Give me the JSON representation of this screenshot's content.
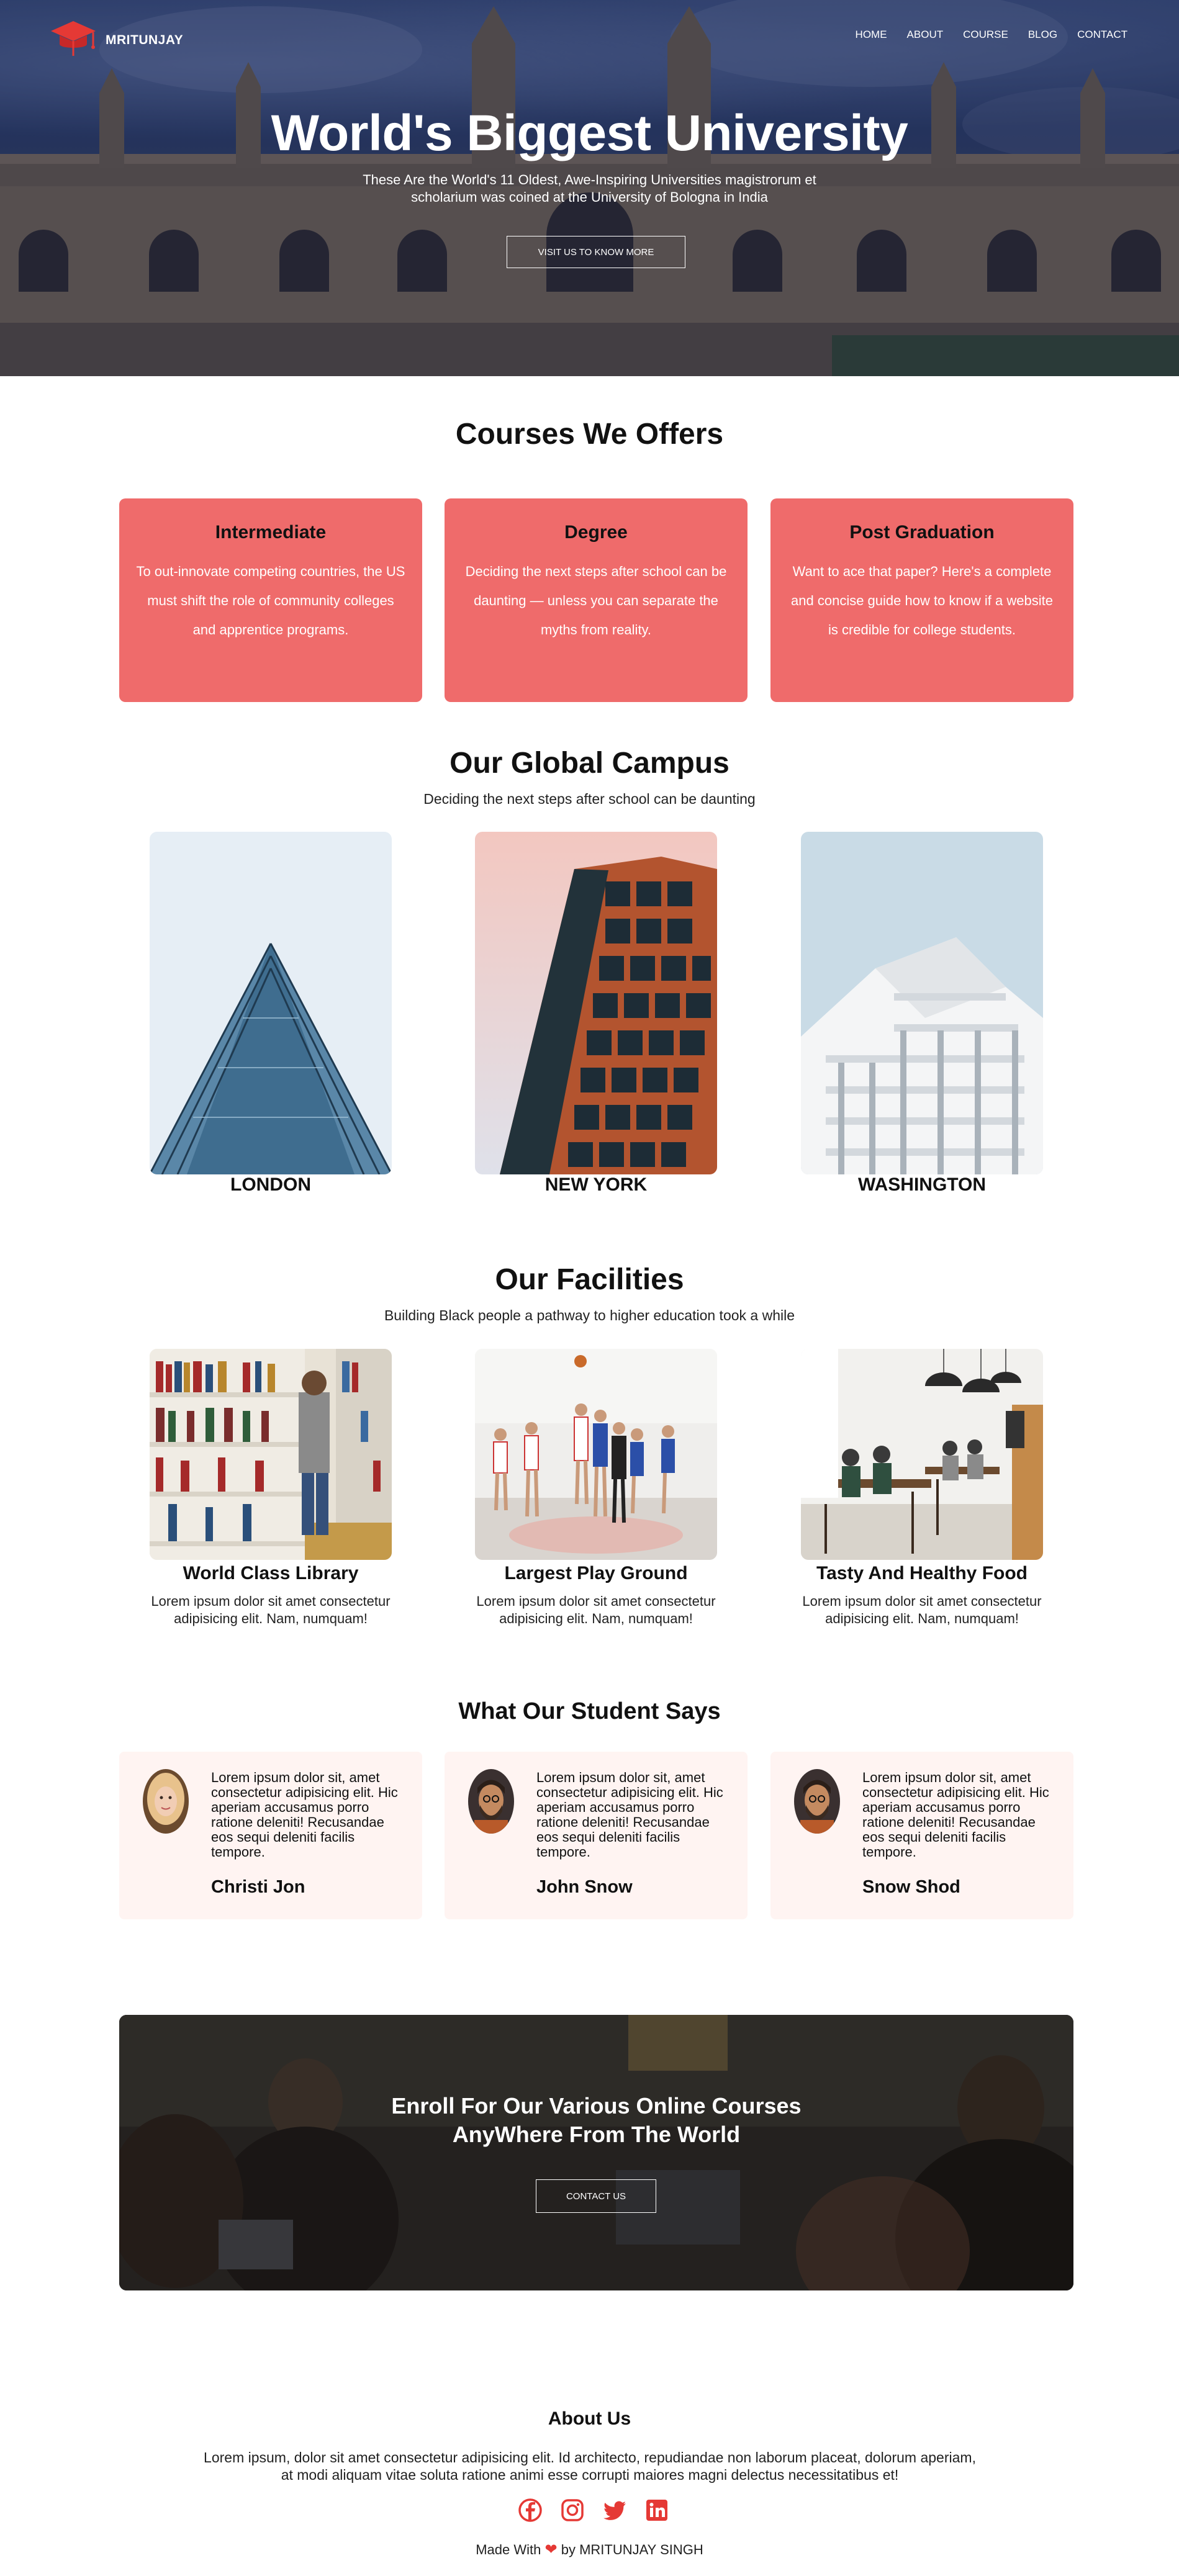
{
  "nav": {
    "brand": "MRITUNJAY",
    "links": [
      "HOME",
      "ABOUT",
      "COURSE",
      "BLOG",
      "CONTACT"
    ]
  },
  "hero": {
    "title": "World's Biggest University",
    "subtitle_line1": "These Are the World's 11 Oldest, Awe-Inspiring Universities magistrorum et",
    "subtitle_line2": "scholarium was coined at the University of Bologna in India",
    "button": "VISIT US TO KNOW MORE"
  },
  "courses": {
    "title": "Courses We Offers",
    "cards": [
      {
        "title": "Intermediate",
        "text": "To out-innovate competing countries, the US must shift the role of community colleges and apprentice programs."
      },
      {
        "title": "Degree",
        "text": "Deciding the next steps after school can be daunting — unless you can separate the myths from reality."
      },
      {
        "title": "Post Graduation",
        "text": "Want to ace that paper? Here's a complete and concise guide how to know if a website is credible for college students."
      }
    ]
  },
  "campus": {
    "title": "Our Global Campus",
    "subtitle": "Deciding the next steps after school can be daunting",
    "locations": [
      "LONDON",
      "NEW YORK",
      "WASHINGTON"
    ]
  },
  "facilities": {
    "title": "Our Facilities",
    "subtitle": "Building Black people a pathway to higher education took a while",
    "items": [
      {
        "title": "World Class Library",
        "text": "Lorem ipsum dolor sit amet consectetur adipisicing elit. Nam, numquam!"
      },
      {
        "title": "Largest Play Ground",
        "text": "Lorem ipsum dolor sit amet consectetur adipisicing elit. Nam, numquam!"
      },
      {
        "title": "Tasty And Healthy Food",
        "text": "Lorem ipsum dolor sit amet consectetur adipisicing elit. Nam, numquam!"
      }
    ]
  },
  "testimonials": {
    "title": "What Our Student Says",
    "items": [
      {
        "text": "Lorem ipsum dolor sit, amet consectetur adipisicing elit. Hic aperiam accusamus porro ratione deleniti! Recusandae eos sequi deleniti facilis tempore.",
        "name": "Christi Jon"
      },
      {
        "text": "Lorem ipsum dolor sit, amet consectetur adipisicing elit. Hic aperiam accusamus porro ratione deleniti! Recusandae eos sequi deleniti facilis tempore.",
        "name": "John Snow"
      },
      {
        "text": "Lorem ipsum dolor sit, amet consectetur adipisicing elit. Hic aperiam accusamus porro ratione deleniti! Recusandae eos sequi deleniti facilis tempore.",
        "name": "Snow Shod"
      }
    ]
  },
  "enroll": {
    "title_line1": "Enroll For Our Various Online Courses",
    "title_line2": "AnyWhere From The World",
    "button": "CONTACT US"
  },
  "about": {
    "title": "About Us",
    "text_line1": "Lorem ipsum, dolor sit amet consectetur adipisicing elit. Id architecto, repudiandae non laborum placeat, dolorum aperiam,",
    "text_line2": "at modi aliquam vitae soluta ratione animi esse corrupti maiores magni delectus necessitatibus et!",
    "socials": [
      "facebook-icon",
      "instagram-icon",
      "twitter-icon",
      "linkedin-icon"
    ]
  },
  "footer": {
    "made_prefix": "Made With",
    "heart": "❤",
    "made_suffix": "by MRITUNJAY SINGH"
  },
  "colors": {
    "accent": "#e53935",
    "course_card": "#ef6b6b",
    "testimonial_card": "#fff4f2"
  }
}
